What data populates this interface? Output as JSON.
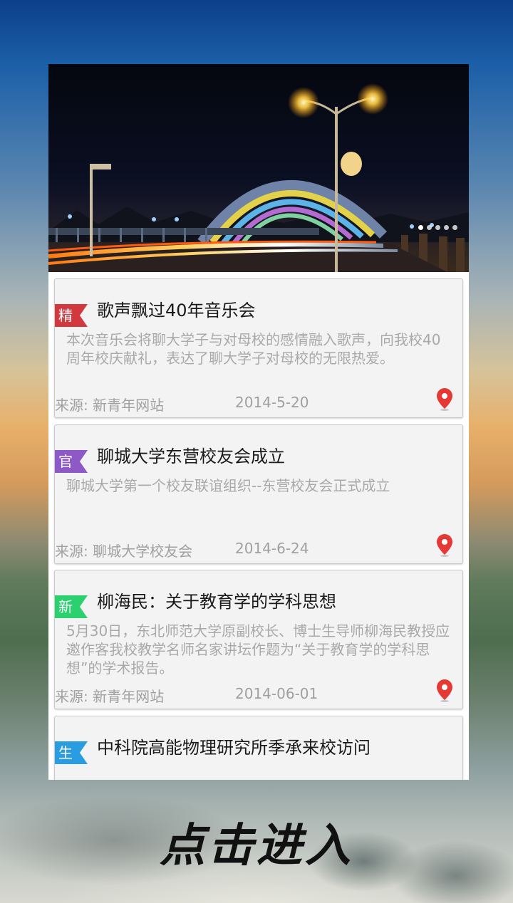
{
  "banner": {
    "description_alt": "",
    "dots_total": 5,
    "dots_active_index": 0
  },
  "colors": {
    "tag_jing": "#d2393f",
    "tag_guan": "#8c59c6",
    "tag_xin": "#2bd16e",
    "tag_sheng": "#2a9de2",
    "pin": "#e53935"
  },
  "news": [
    {
      "tag": "精",
      "title": "歌声飘过40年音乐会",
      "summary": "本次音乐会将聊大学子与对母校的感情融入歌声，向我校40周年校庆献礼，表达了聊大学子对母校的无限热爱。",
      "source": "来源: 新青年网站",
      "date": "2014-5-20"
    },
    {
      "tag": "官",
      "title": "聊城大学东营校友会成立",
      "summary": "聊城大学第一个校友联谊组织--东营校友会正式成立",
      "source": "来源: 聊城大学校友会",
      "date": "2014-6-24"
    },
    {
      "tag": "新",
      "title": "柳海民：关于教育学的学科思想",
      "summary": "5月30日，东北师范大学原副校长、博士生导师柳海民教授应邀作客我校教学名师名家讲坛作题为“关于教育学的学科思想”的学术报告。",
      "source": "来源: 新青年网站",
      "date": "2014-06-01"
    },
    {
      "tag": "生",
      "title": "中科院高能物理研究所季承来校访问",
      "summary": "",
      "source": "",
      "date": ""
    }
  ],
  "enter_label": "点击进入"
}
